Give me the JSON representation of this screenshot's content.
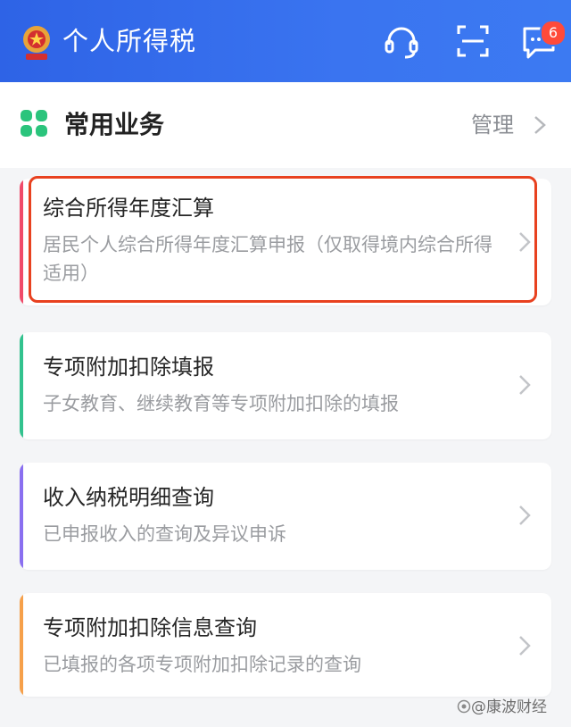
{
  "header": {
    "title": "个人所得税",
    "icons": [
      "emblem-icon",
      "headset-icon",
      "scan-icon",
      "message-icon"
    ],
    "message_badge": "6",
    "bg_color": "#3a74f0"
  },
  "section": {
    "title": "常用业务",
    "manage_label": "管理",
    "icon": "grid-icon",
    "accent": "#2bc47c"
  },
  "cards": [
    {
      "title": "综合所得年度汇算",
      "desc": "居民个人综合所得年度汇算申报（仅取得境内综合所得适用）",
      "stripe_color": "#f04b6a",
      "highlighted": true
    },
    {
      "title": "专项附加扣除填报",
      "desc": "子女教育、继续教育等专项附加扣除的填报",
      "stripe_color": "#32c28e"
    },
    {
      "title": "收入纳税明细查询",
      "desc": "已申报收入的查询及异议申诉",
      "stripe_color": "#8a6ff0"
    },
    {
      "title": "专项附加扣除信息查询",
      "desc": "已填报的各项专项附加扣除记录的查询",
      "stripe_color": "#f6a04a"
    }
  ],
  "watermark": "@康波财经"
}
